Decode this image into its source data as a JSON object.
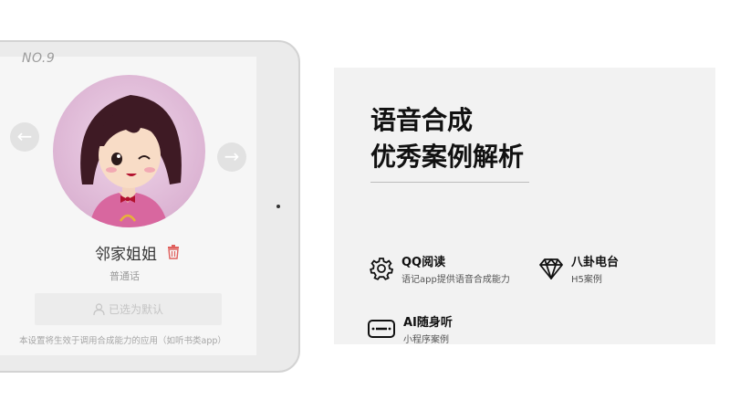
{
  "voice_card": {
    "number": "NO.9",
    "name": "邻家姐姐",
    "language": "普通话",
    "default_button_label": "已选为默认",
    "footnote": "本设置将生效于调用合成能力的应用（如听书类app）"
  },
  "panel": {
    "title_line1": "语音合成",
    "title_line2": "优秀案例解析",
    "cases": [
      {
        "title": "QQ阅读",
        "desc": "语记app提供语音合成能力",
        "icon": "gear-icon"
      },
      {
        "title": "八卦电台",
        "desc": "H5案例",
        "icon": "diamond-icon"
      },
      {
        "title": "AI随身听",
        "desc": "小程序案例",
        "icon": "speaker-icon"
      }
    ]
  },
  "colors": {
    "panel_bg": "#f2f2f2",
    "trash_icon": "#e0605d",
    "avatar_bg": "#dcb4d3"
  }
}
